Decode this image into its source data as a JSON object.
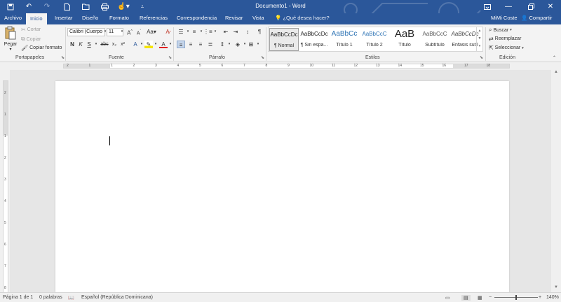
{
  "titlebar": {
    "title": "Documento1 - Word",
    "qat": {
      "save_icon": "save-icon",
      "undo_icon": "undo-icon",
      "redo_icon": "redo-icon",
      "new_icon": "new-document-icon",
      "open_icon": "open-folder-icon",
      "print_icon": "print-icon",
      "touch_icon": "touch-mode-icon",
      "customize_icon": "customize-qat-icon"
    },
    "window": {
      "ribbon_options": "ribbon-display-options-icon",
      "minimize": "minimize-icon",
      "restore": "restore-icon",
      "close": "close-icon"
    }
  },
  "tabs": [
    {
      "label": "Archivo",
      "active": false
    },
    {
      "label": "Inicio",
      "active": true
    },
    {
      "label": "Insertar",
      "active": false
    },
    {
      "label": "Diseño",
      "active": false
    },
    {
      "label": "Formato",
      "active": false
    },
    {
      "label": "Referencias",
      "active": false
    },
    {
      "label": "Correspondencia",
      "active": false
    },
    {
      "label": "Revisar",
      "active": false
    },
    {
      "label": "Vista",
      "active": false
    }
  ],
  "tellme": {
    "label": "¿Qué desea hacer?"
  },
  "user": {
    "name": "MiMi Coste"
  },
  "share": {
    "label": "Compartir"
  },
  "clipboard": {
    "paste": "Pegar",
    "cut": "Cortar",
    "copy": "Copiar",
    "format_painter": "Copiar formato",
    "group": "Portapapeles"
  },
  "font": {
    "family": "Calibri (Cuerpo",
    "size": "11",
    "grow": "A",
    "shrink": "A",
    "case": "Aa",
    "bold": "N",
    "italic": "K",
    "underline": "S",
    "strike": "abc",
    "subscript": "x₂",
    "superscript": "x²",
    "font_color": "A",
    "group": "Fuente"
  },
  "paragraph": {
    "group": "Párrafo"
  },
  "styles": {
    "group": "Estilos",
    "items": [
      {
        "sample": "AaBbCcDc",
        "name": "¶ Normal"
      },
      {
        "sample": "AaBbCcDc",
        "name": "¶ Sin espa..."
      },
      {
        "sample": "AaBbCc",
        "name": "Título 1"
      },
      {
        "sample": "AaBbCcC",
        "name": "Título 2"
      },
      {
        "sample": "AaB",
        "name": "Título"
      },
      {
        "sample": "AaBbCcC",
        "name": "Subtítulo"
      },
      {
        "sample": "AaBbCcDc",
        "name": "Énfasis sutil"
      }
    ]
  },
  "editing": {
    "find": "Buscar",
    "replace": "Reemplazar",
    "select": "Seleccionar",
    "group": "Edición"
  },
  "ruler": {
    "h_numbers": [
      "2",
      "1",
      "1",
      "2",
      "3",
      "4",
      "5",
      "6",
      "7",
      "8",
      "9",
      "10",
      "11",
      "12",
      "13",
      "14",
      "15",
      "16",
      "17",
      "18"
    ],
    "v_numbers": [
      "2",
      "1",
      "1",
      "2",
      "3",
      "4",
      "5",
      "6",
      "7",
      "8"
    ]
  },
  "status": {
    "page": "Página 1 de 1",
    "words": "0 palabras",
    "language": "Español (República Dominicana)",
    "zoom": "140%",
    "minus": "−",
    "plus": "+"
  }
}
